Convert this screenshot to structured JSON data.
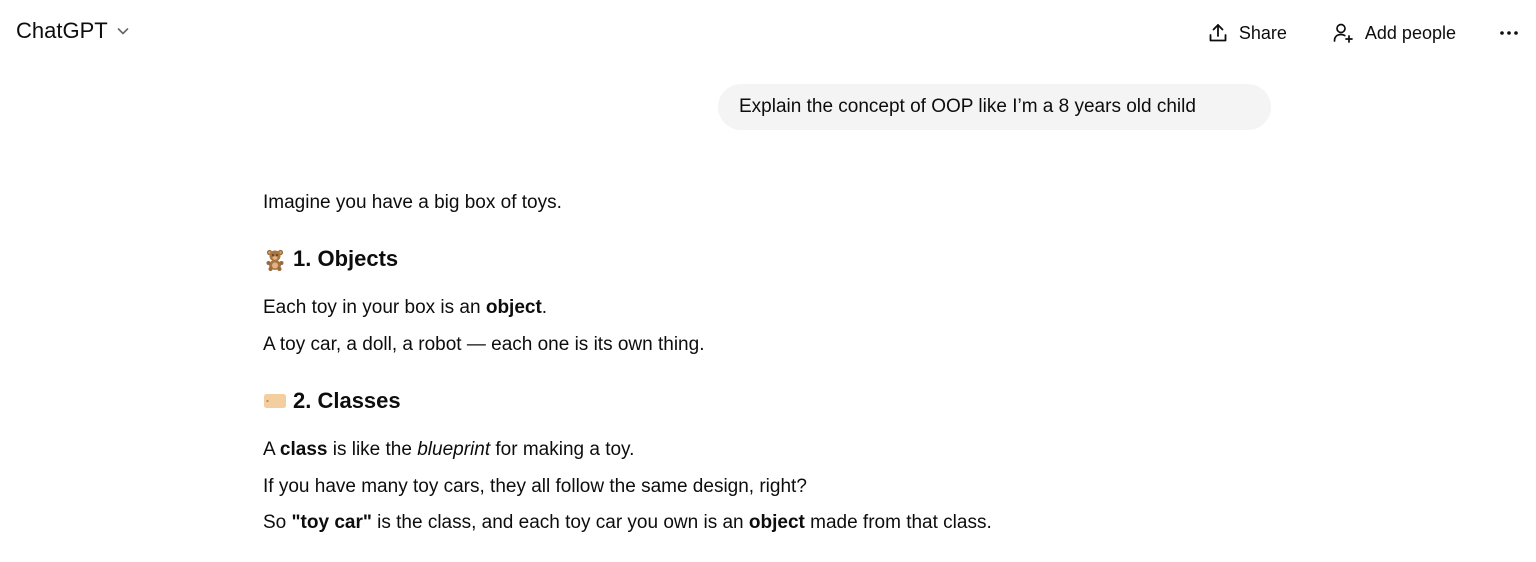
{
  "header": {
    "model_name": "ChatGPT",
    "share_label": "Share",
    "add_people_label": "Add people"
  },
  "user_message": {
    "text": "Explain the concept of OOP like I’m a 8 years old child"
  },
  "assistant": {
    "intro": "Imagine you have a big box of toys.",
    "section1": {
      "emoji": "teddy-bear-icon",
      "title": "1. Objects",
      "line1_before": "Each toy in your box is an ",
      "line1_bold": "object",
      "line1_after": ".",
      "line2": "A toy car, a doll, a robot — each one is its own thing."
    },
    "section2": {
      "emoji": "label-tag-icon",
      "title": "2. Classes",
      "line1_before": "A ",
      "line1_bold": "class",
      "line1_mid": " is like the ",
      "line1_italic": "blueprint",
      "line1_after": " for making a toy.",
      "line2": "If you have many toy cars, they all follow the same design, right?",
      "line3_before": "So ",
      "line3_bold1": "\"toy car\"",
      "line3_mid": " is the class, and each toy car you own is an ",
      "line3_bold2": "object",
      "line3_after": " made from that class."
    }
  },
  "colors": {
    "text": "#0d0d0d",
    "bubble_bg": "#f4f4f4",
    "background": "#ffffff"
  }
}
